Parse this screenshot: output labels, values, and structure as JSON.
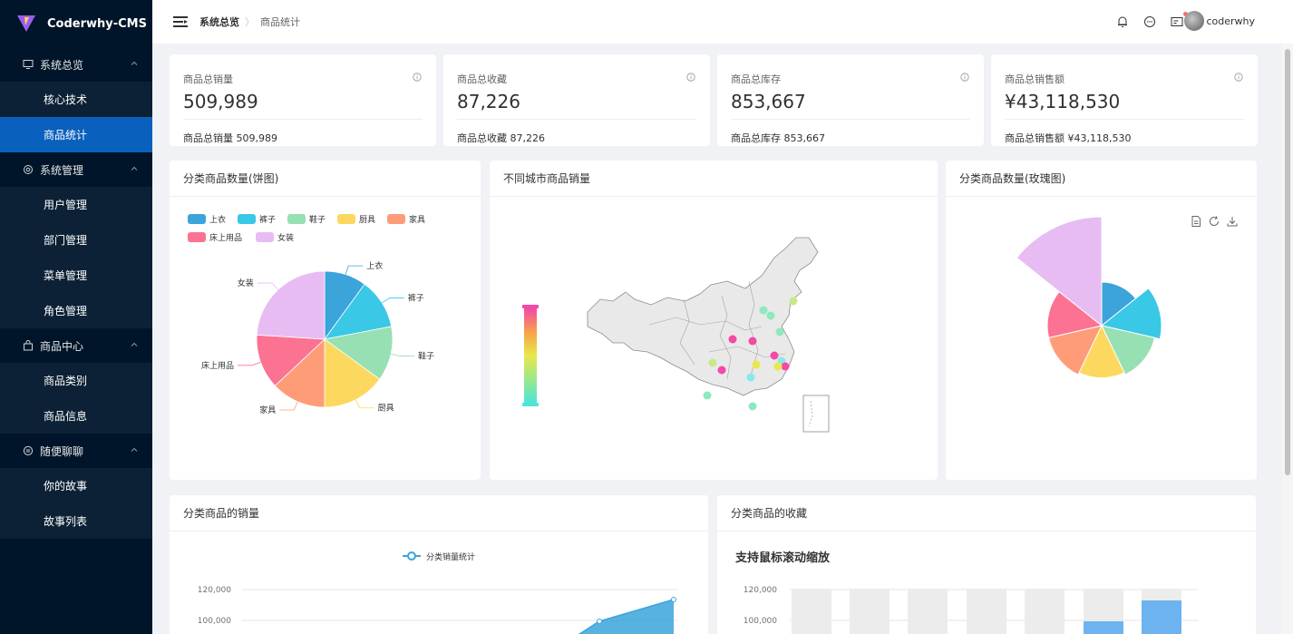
{
  "app": {
    "name": "Coderwhy-CMS"
  },
  "sidebar": {
    "groups": [
      {
        "title": "系统总览",
        "icon": "monitor-icon",
        "items": [
          "核心技术",
          "商品统计"
        ]
      },
      {
        "title": "系统管理",
        "icon": "settings-icon",
        "items": [
          "用户管理",
          "部门管理",
          "菜单管理",
          "角色管理"
        ]
      },
      {
        "title": "商品中心",
        "icon": "goods-icon",
        "items": [
          "商品类别",
          "商品信息"
        ]
      },
      {
        "title": "随便聊聊",
        "icon": "chat-icon",
        "items": [
          "你的故事",
          "故事列表"
        ]
      }
    ],
    "active_item": "商品统计"
  },
  "header": {
    "breadcrumb": [
      "系统总览",
      "商品统计"
    ],
    "separator": "〉",
    "username": "coderwhy"
  },
  "stats": [
    {
      "title": "商品总销量",
      "value": "509,989",
      "footer": "商品总销量 509,989"
    },
    {
      "title": "商品总收藏",
      "value": "87,226",
      "footer": "商品总收藏 87,226"
    },
    {
      "title": "商品总库存",
      "value": "853,667",
      "footer": "商品总库存 853,667"
    },
    {
      "title": "商品总销售额",
      "value": "¥43,118,530",
      "footer": "商品总销售额 ¥43,118,530"
    }
  ],
  "panels": {
    "pie": {
      "title": "分类商品数量(饼图)"
    },
    "map": {
      "title": "不同城市商品销量"
    },
    "rose": {
      "title": "分类商品数量(玫瑰图)"
    },
    "sales": {
      "title": "分类商品的销量"
    },
    "favor": {
      "title": "分类商品的收藏",
      "subtitle": "支持鼠标滚动缩放"
    }
  },
  "colors": {
    "sidebar_bg": "#001529",
    "active": "#0a60bd",
    "categories": [
      "#3ba4da",
      "#39c8e6",
      "#97e0b3",
      "#fdd85e",
      "#ff9c78",
      "#fb7293",
      "#e7bcf3"
    ]
  },
  "chart_data": [
    {
      "type": "pie",
      "title": "分类商品数量(饼图)",
      "categories": [
        "上衣",
        "裤子",
        "鞋子",
        "厨具",
        "家具",
        "床上用品",
        "女装"
      ],
      "values": [
        10,
        12,
        13,
        15,
        13,
        13,
        24
      ]
    },
    {
      "type": "pie",
      "variant": "rose",
      "title": "分类商品数量(玫瑰图)",
      "categories": [
        "上衣",
        "裤子",
        "鞋子",
        "厨具",
        "家具",
        "床上用品",
        "女装"
      ],
      "values": [
        40,
        55,
        50,
        48,
        50,
        50,
        100
      ]
    },
    {
      "type": "area",
      "title": "分类商品的销量",
      "legend": [
        "分类销量统计"
      ],
      "yticks": [
        "120,000",
        "100,000"
      ]
    },
    {
      "type": "bar",
      "title": "分类商品的收藏",
      "subtitle": "支持鼠标滚动缩放",
      "yticks": [
        "120,000",
        "100,000"
      ]
    }
  ]
}
